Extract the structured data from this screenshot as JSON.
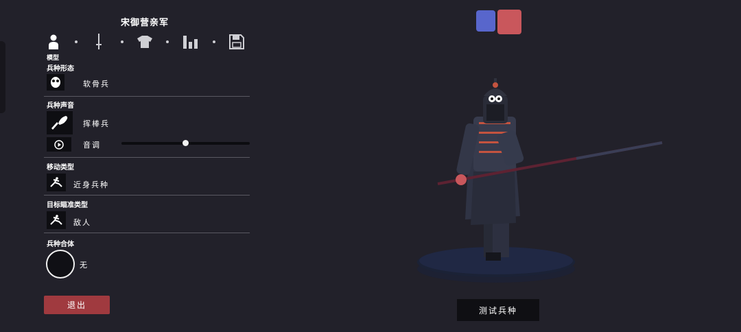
{
  "unit": {
    "name": "宋御营亲军"
  },
  "tabs": {
    "active_label": "模型",
    "items": [
      "model-tab",
      "weapon-tab",
      "armor-tab",
      "stats-tab",
      "save-tab"
    ]
  },
  "sections": {
    "body_type": {
      "label": "兵种形态",
      "value": "软骨兵"
    },
    "voice": {
      "label": "兵种声音",
      "value": "挥棒兵",
      "pitch_label": "音调",
      "pitch_level": 0.5
    },
    "movement": {
      "label": "移动类型",
      "value": "近身兵种"
    },
    "targeting": {
      "label": "目标瞄准类型",
      "value": "敌人"
    },
    "combine": {
      "label": "兵种合体",
      "value": "无"
    }
  },
  "buttons": {
    "exit": "退出",
    "test_unit": "测试兵种"
  },
  "team_colors": {
    "blue": "#5866cc",
    "red": "#c9575c"
  }
}
